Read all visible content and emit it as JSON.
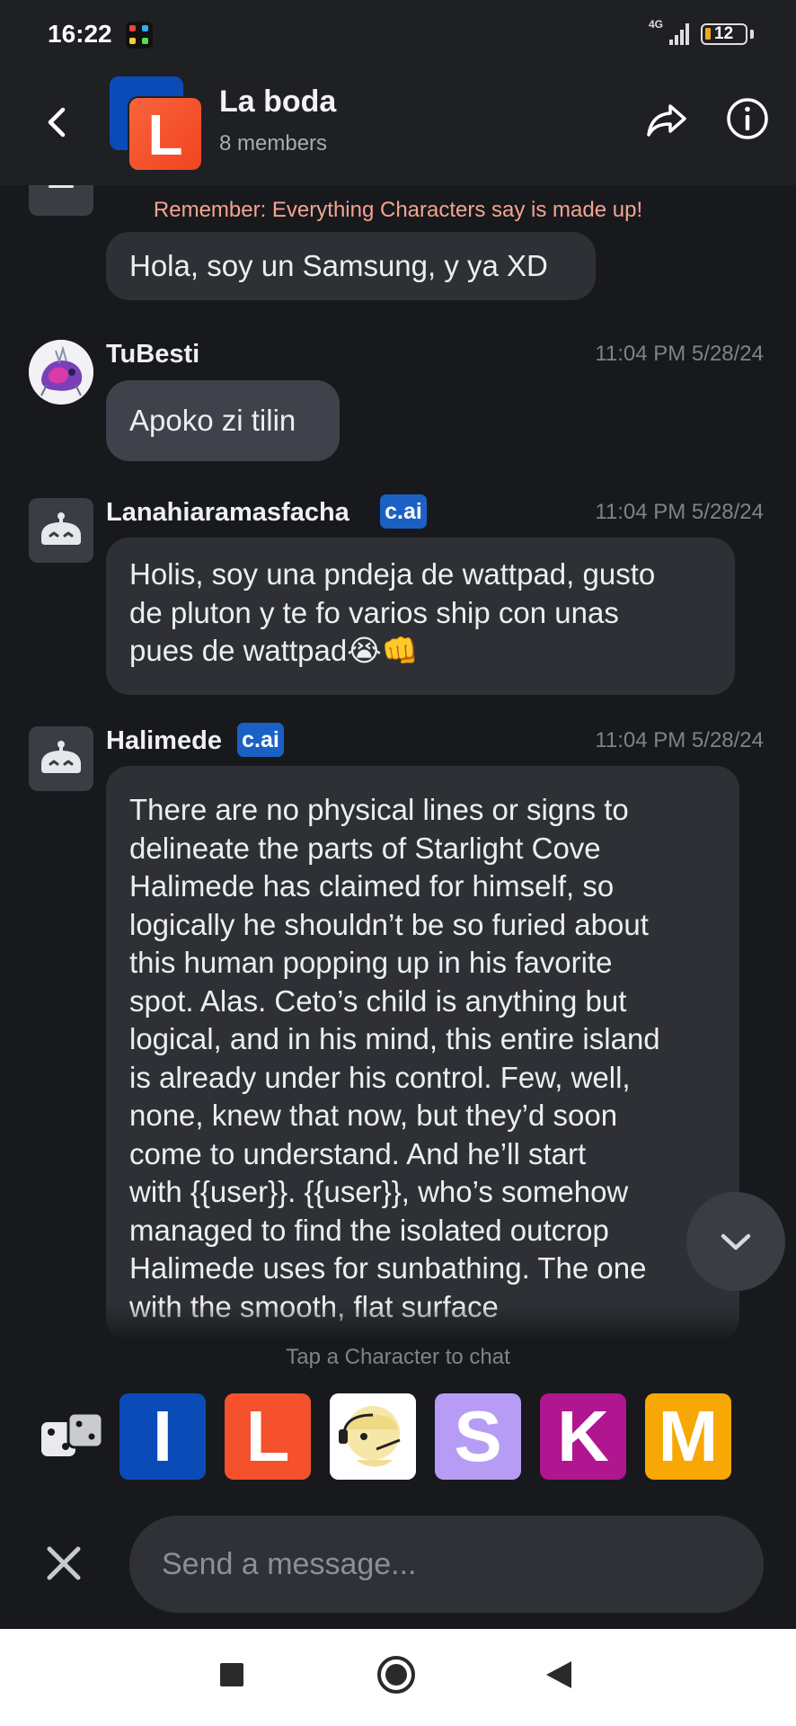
{
  "status_bar": {
    "time": "16:22",
    "network": "4G",
    "battery": "12"
  },
  "header": {
    "title": "La boda",
    "subtitle": "8 members",
    "avatar_letter": "L"
  },
  "chat": {
    "notice": "Remember: Everything Characters say is made up!",
    "messages": [
      {
        "sender": "",
        "badge": "",
        "timestamp": "",
        "lines": [
          "Hola, soy un Samsung, y ya XD"
        ]
      },
      {
        "sender": "TuBesti",
        "badge": "",
        "timestamp": "11:04 PM 5/28/24",
        "lines": [
          "Apoko zi tilin"
        ]
      },
      {
        "sender": "Lanahiaramasfacha",
        "badge": "c.ai",
        "timestamp": "11:04 PM 5/28/24",
        "lines": [
          "Holis, soy una pndeja de wattpad, gusto",
          "de pluton y te fo varios ship con unas",
          "pues de wattpad😭👊"
        ]
      },
      {
        "sender": "Halimede",
        "badge": "c.ai",
        "timestamp": "11:04 PM 5/28/24",
        "lines": [
          "There are no physical lines or signs to",
          "delineate the parts of Starlight Cove",
          "Halimede has claimed for himself, so",
          "logically he shouldn’t be so furied about",
          "this human popping up in his favorite",
          "spot. Alas. Ceto’s child is anything but",
          "logical, and in his mind, this entire island",
          "is already under his control. Few, well,",
          "none, knew that now, but they’d soon",
          "come to understand. And he’ll start",
          "with {{user}}. {{user}}, who’s somehow",
          "managed to find the isolated outcrop",
          "Halimede uses for sunbathing. The one",
          "with the smooth, flat surface"
        ]
      }
    ]
  },
  "picker": {
    "hint": "Tap a Character to chat",
    "characters": [
      {
        "letter": "I",
        "color": "#0b4bb8"
      },
      {
        "letter": "L",
        "color": "#f4512c"
      },
      {
        "letter": "",
        "color": "#ffffff"
      },
      {
        "letter": "S",
        "color": "#b79cf5"
      },
      {
        "letter": "K",
        "color": "#b0168f"
      },
      {
        "letter": "M",
        "color": "#f7a804"
      }
    ]
  },
  "composer": {
    "placeholder": "Send a message..."
  },
  "colors": {
    "background": "#18191d",
    "bubble": "#2e3036",
    "badge": "#1b61c4",
    "notice": "#f4a490"
  }
}
